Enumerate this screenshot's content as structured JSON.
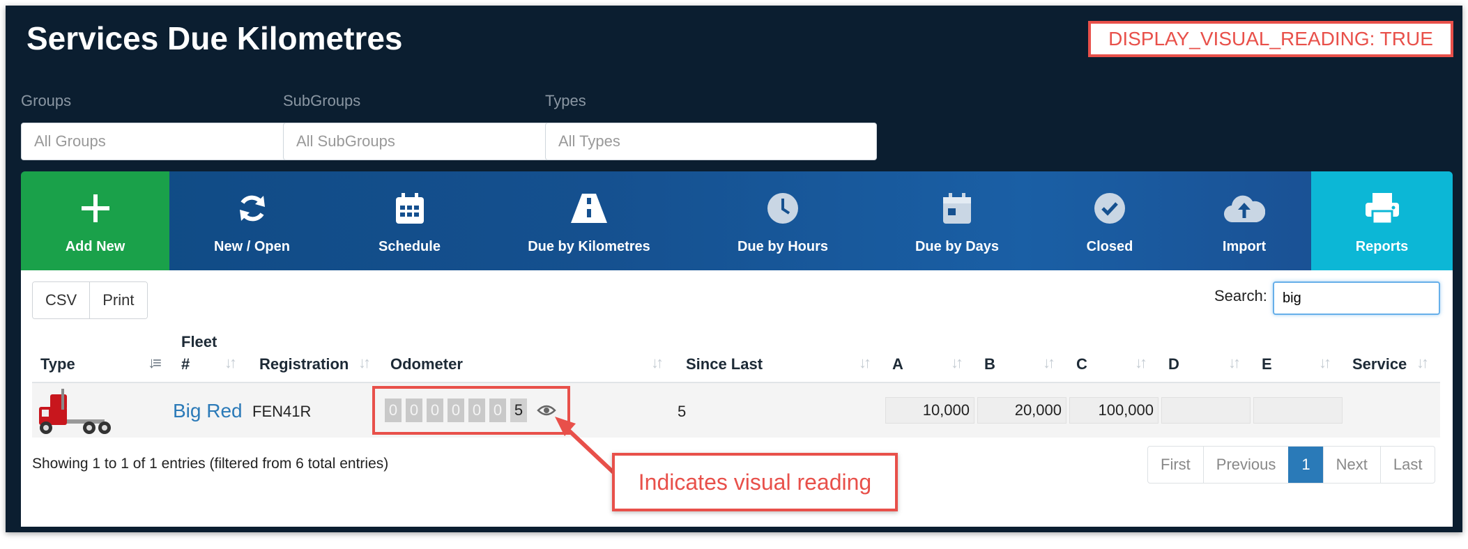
{
  "page": {
    "title": "Services Due Kilometres"
  },
  "annotations": {
    "flag": "DISPLAY_VISUAL_READING: TRUE",
    "callout": "Indicates visual reading",
    "accent_color": "#e8504a"
  },
  "filters": [
    {
      "label": "Groups",
      "placeholder": "All Groups"
    },
    {
      "label": "SubGroups",
      "placeholder": "All SubGroups"
    },
    {
      "label": "Types",
      "placeholder": "All Types"
    }
  ],
  "toolbar": {
    "items": [
      {
        "label": "Add New",
        "icon": "plus-icon"
      },
      {
        "label": "New / Open",
        "icon": "refresh-icon"
      },
      {
        "label": "Schedule",
        "icon": "calendar-grid-icon"
      },
      {
        "label": "Due by Kilometres",
        "icon": "road-icon"
      },
      {
        "label": "Due by Hours",
        "icon": "clock-icon"
      },
      {
        "label": "Due by Days",
        "icon": "calendar-day-icon"
      },
      {
        "label": "Closed",
        "icon": "check-circle-icon"
      },
      {
        "label": "Import",
        "icon": "cloud-upload-icon"
      },
      {
        "label": "Reports",
        "icon": "printer-icon"
      }
    ],
    "colors": {
      "add": "#1aa14a",
      "reports": "#0cb7d6",
      "bar": "#15508f"
    }
  },
  "table_tools": {
    "csv_label": "CSV",
    "print_label": "Print",
    "search_label": "Search:",
    "search_value": "big"
  },
  "table": {
    "columns": [
      "Type",
      "Fleet #",
      "Registration",
      "Odometer",
      "Since Last",
      "A",
      "B",
      "C",
      "D",
      "E",
      "Service"
    ],
    "fleet_col": {
      "line1": "Fleet",
      "line2": "#"
    },
    "rows": [
      {
        "type_icon": "truck-icon",
        "fleet": "Big Red",
        "registration": "FEN41R",
        "odometer_digits": [
          "0",
          "0",
          "0",
          "0",
          "0",
          "0",
          "5"
        ],
        "visual_reading_icon": "eye-icon",
        "since_last": "5",
        "a": "10,000",
        "b": "20,000",
        "c": "100,000",
        "d": "",
        "e": "",
        "service": ""
      }
    ]
  },
  "footer": {
    "info": "Showing 1 to 1 of 1 entries (filtered from 6 total entries)",
    "pagination": [
      "First",
      "Previous",
      "1",
      "Next",
      "Last"
    ],
    "current_page": "1"
  }
}
